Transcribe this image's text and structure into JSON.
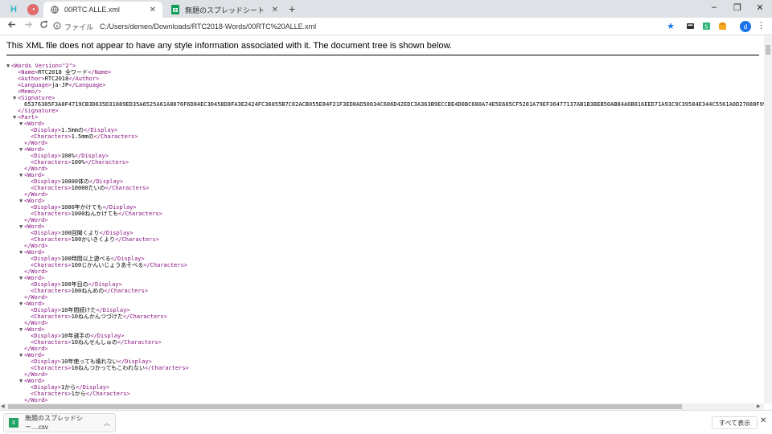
{
  "tabs": [
    {
      "title": "00RTC ALLE.xml",
      "active": true
    },
    {
      "title": "無題のスプレッドシート - Google スプ",
      "active": false
    }
  ],
  "new_tab_label": "+",
  "window_controls": {
    "minimize": "–",
    "maximize": "❐",
    "close": "✕"
  },
  "toolbar": {
    "scheme_label": "ファイル",
    "url": "C:/Users/demen/Downloads/RTC2018-Words/00RTC%20ALLE.xml",
    "avatar_letter": "d"
  },
  "banner": "This XML file does not appear to have any style information associated with it. The document tree is shown below.",
  "xml_lines": [
    {
      "indent": 0,
      "tri": "▼",
      "open": "<Words Version=\"2\">",
      "text": "",
      "close": ""
    },
    {
      "indent": 1,
      "tri": "",
      "open": "<Name>",
      "text": "RTC2018 全ワード",
      "close": "</Name>"
    },
    {
      "indent": 1,
      "tri": "",
      "open": "<Author>",
      "text": "RTC2018",
      "close": "</Author>"
    },
    {
      "indent": 1,
      "tri": "",
      "open": "<Language>",
      "text": "ja-JP",
      "close": "</Language>"
    },
    {
      "indent": 1,
      "tri": "",
      "open": "<Memo/>",
      "text": "",
      "close": ""
    },
    {
      "indent": 1,
      "tri": "▼",
      "open": "<Signature>",
      "text": "",
      "close": ""
    },
    {
      "indent": 2,
      "tri": "",
      "open": "",
      "text": "65376305F3A0F4719CB3D635D31089ED35A6525A61A8076F6D84EC30458D8FA3E2424FC36055B7C02ACB055E84F21F3ED8AD50034C606D42EDC3A363B9ECCBE4D0BC680A74E5E665CF5281A79EF36477137AB1B3BEB50AB84A6B016EED71A93C9C39584E344C5561A0D27088F99AC3844C4372",
      "close": ""
    },
    {
      "indent": 1,
      "tri": "",
      "open": "</Signature>",
      "text": "",
      "close": ""
    },
    {
      "indent": 1,
      "tri": "▼",
      "open": "<Part>",
      "text": "",
      "close": ""
    },
    {
      "indent": 2,
      "tri": "▼",
      "open": "<Word>",
      "text": "",
      "close": ""
    },
    {
      "indent": 3,
      "tri": "",
      "open": "<Display>",
      "text": "1.5mmの",
      "close": "</Display>"
    },
    {
      "indent": 3,
      "tri": "",
      "open": "<Characters>",
      "text": "1.5mmの",
      "close": "</Characters>"
    },
    {
      "indent": 2,
      "tri": "",
      "open": "</Word>",
      "text": "",
      "close": ""
    },
    {
      "indent": 2,
      "tri": "▼",
      "open": "<Word>",
      "text": "",
      "close": ""
    },
    {
      "indent": 3,
      "tri": "",
      "open": "<Display>",
      "text": "100%",
      "close": "</Display>"
    },
    {
      "indent": 3,
      "tri": "",
      "open": "<Characters>",
      "text": "100%",
      "close": "</Characters>"
    },
    {
      "indent": 2,
      "tri": "",
      "open": "</Word>",
      "text": "",
      "close": ""
    },
    {
      "indent": 2,
      "tri": "▼",
      "open": "<Word>",
      "text": "",
      "close": ""
    },
    {
      "indent": 3,
      "tri": "",
      "open": "<Display>",
      "text": "10000体の",
      "close": "</Display>"
    },
    {
      "indent": 3,
      "tri": "",
      "open": "<Characters>",
      "text": "10000たいの",
      "close": "</Characters>"
    },
    {
      "indent": 2,
      "tri": "",
      "open": "</Word>",
      "text": "",
      "close": ""
    },
    {
      "indent": 2,
      "tri": "▼",
      "open": "<Word>",
      "text": "",
      "close": ""
    },
    {
      "indent": 3,
      "tri": "",
      "open": "<Display>",
      "text": "1000年かけても",
      "close": "</Display>"
    },
    {
      "indent": 3,
      "tri": "",
      "open": "<Characters>",
      "text": "1000ねんかけても",
      "close": "</Characters>"
    },
    {
      "indent": 2,
      "tri": "",
      "open": "</Word>",
      "text": "",
      "close": ""
    },
    {
      "indent": 2,
      "tri": "▼",
      "open": "<Word>",
      "text": "",
      "close": ""
    },
    {
      "indent": 3,
      "tri": "",
      "open": "<Display>",
      "text": "100回聞くより",
      "close": "</Display>"
    },
    {
      "indent": 3,
      "tri": "",
      "open": "<Characters>",
      "text": "100かいきくより",
      "close": "</Characters>"
    },
    {
      "indent": 2,
      "tri": "",
      "open": "</Word>",
      "text": "",
      "close": ""
    },
    {
      "indent": 2,
      "tri": "▼",
      "open": "<Word>",
      "text": "",
      "close": ""
    },
    {
      "indent": 3,
      "tri": "",
      "open": "<Display>",
      "text": "100時間以上遊べる",
      "close": "</Display>"
    },
    {
      "indent": 3,
      "tri": "",
      "open": "<Characters>",
      "text": "100じかんいじょうあそべる",
      "close": "</Characters>"
    },
    {
      "indent": 2,
      "tri": "",
      "open": "</Word>",
      "text": "",
      "close": ""
    },
    {
      "indent": 2,
      "tri": "▼",
      "open": "<Word>",
      "text": "",
      "close": ""
    },
    {
      "indent": 3,
      "tri": "",
      "open": "<Display>",
      "text": "100年目の",
      "close": "</Display>"
    },
    {
      "indent": 3,
      "tri": "",
      "open": "<Characters>",
      "text": "100ねんめの",
      "close": "</Characters>"
    },
    {
      "indent": 2,
      "tri": "",
      "open": "</Word>",
      "text": "",
      "close": ""
    },
    {
      "indent": 2,
      "tri": "▼",
      "open": "<Word>",
      "text": "",
      "close": ""
    },
    {
      "indent": 3,
      "tri": "",
      "open": "<Display>",
      "text": "10年間続けた",
      "close": "</Display>"
    },
    {
      "indent": 3,
      "tri": "",
      "open": "<Characters>",
      "text": "10ねんかんつづけた",
      "close": "</Characters>"
    },
    {
      "indent": 2,
      "tri": "",
      "open": "</Word>",
      "text": "",
      "close": ""
    },
    {
      "indent": 2,
      "tri": "▼",
      "open": "<Word>",
      "text": "",
      "close": ""
    },
    {
      "indent": 3,
      "tri": "",
      "open": "<Display>",
      "text": "10年選手の",
      "close": "</Display>"
    },
    {
      "indent": 3,
      "tri": "",
      "open": "<Characters>",
      "text": "10ねんせんしゅの",
      "close": "</Characters>"
    },
    {
      "indent": 2,
      "tri": "",
      "open": "</Word>",
      "text": "",
      "close": ""
    },
    {
      "indent": 2,
      "tri": "▼",
      "open": "<Word>",
      "text": "",
      "close": ""
    },
    {
      "indent": 3,
      "tri": "",
      "open": "<Display>",
      "text": "10年使っても壊れない",
      "close": "</Display>"
    },
    {
      "indent": 3,
      "tri": "",
      "open": "<Characters>",
      "text": "10ねんつかってもこわれない",
      "close": "</Characters>"
    },
    {
      "indent": 2,
      "tri": "",
      "open": "</Word>",
      "text": "",
      "close": ""
    },
    {
      "indent": 2,
      "tri": "▼",
      "open": "<Word>",
      "text": "",
      "close": ""
    },
    {
      "indent": 3,
      "tri": "",
      "open": "<Display>",
      "text": "1から",
      "close": "</Display>"
    },
    {
      "indent": 3,
      "tri": "",
      "open": "<Characters>",
      "text": "1から",
      "close": "</Characters>"
    },
    {
      "indent": 2,
      "tri": "",
      "open": "</Word>",
      "text": "",
      "close": ""
    }
  ],
  "download": {
    "filename": "無題のスプレッドシー....csv",
    "show_all": "すべて表示",
    "close": "✕"
  },
  "colors": {
    "tag": "#881280",
    "tabstrip": "#dee1e6",
    "star": "#1a73e8"
  }
}
